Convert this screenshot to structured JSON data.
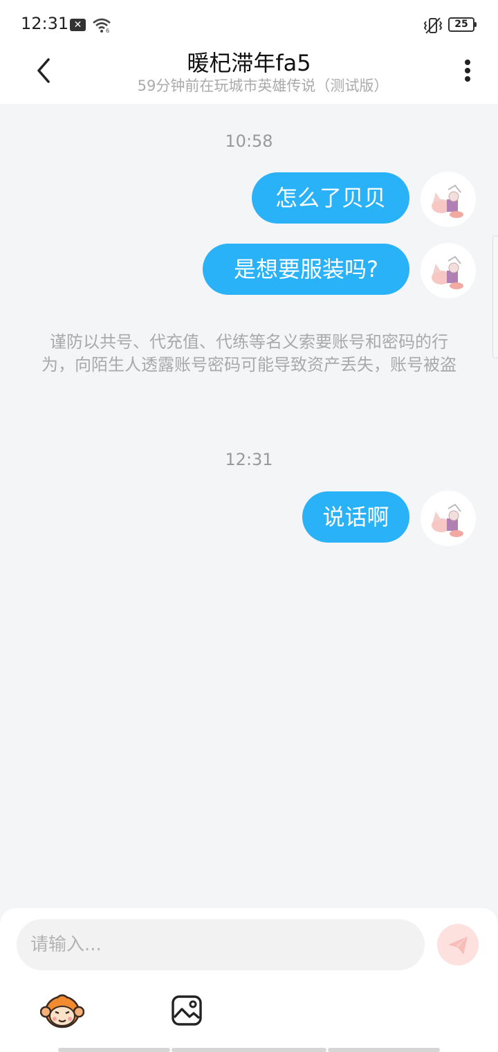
{
  "status_bar": {
    "time": "12:31",
    "battery": "25"
  },
  "header": {
    "title": "暖杞滞年fa5",
    "subtitle": "59分钟前在玩城市英雄传说（测试版）"
  },
  "messages": {
    "time_1": "10:58",
    "msg_1": "怎么了贝贝",
    "msg_2": "是想要服装吗?",
    "warning": "谨防以共号、代充值、代练等名义索要账号和密码的行为，向陌生人透露账号密码可能导致资产丢失，账号被盗",
    "time_2": "12:31",
    "msg_3": "说话啊"
  },
  "composer": {
    "placeholder": "请输入..."
  },
  "colors": {
    "bubble": "#29b2f7",
    "send": "#fde1df",
    "background": "#f4f5f7"
  }
}
